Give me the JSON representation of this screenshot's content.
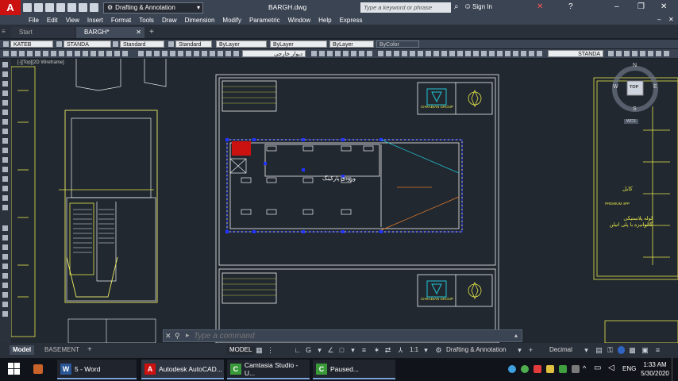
{
  "app": {
    "logo_letter": "A",
    "workspace": "Drafting & Annotation",
    "doc_title": "BARGH.dwg",
    "search_placeholder": "Type a keyword or phrase",
    "signin": "Sign In"
  },
  "menu": [
    "File",
    "Edit",
    "View",
    "Insert",
    "Format",
    "Tools",
    "Draw",
    "Dimension",
    "Modify",
    "Parametric",
    "Window",
    "Help",
    "Express"
  ],
  "tabs": [
    {
      "label": "Start"
    },
    {
      "label": "BARGH*"
    }
  ],
  "props": {
    "textstyle": "KATEB",
    "dimstyle": "STANDA",
    "tablestyle": "Standard",
    "mlstyle": "Standard",
    "layer": "ByLayer",
    "linetype": "ByLayer",
    "lineweight": "ByLayer",
    "color": "ByColor"
  },
  "layer_row": {
    "layer_name": "STANDA",
    "arabic_layer": "دیوار خارجی"
  },
  "viewport": {
    "label": "[-][Top][2D Wireframe]",
    "viewcube_top": "TOP",
    "compass": {
      "n": "N",
      "s": "S",
      "w": "W",
      "e": "E"
    },
    "wcs": "WCS"
  },
  "drawing": {
    "parking_label": "ورودی پارکینگ",
    "logo_text": "CHRABIAN GROUP",
    "legend_1": "کابل",
    "legend_2": "لوله پلاستیکی گالوانیزه با پلی اتیلن",
    "legend_small": "PREMIUM 4PP"
  },
  "command": {
    "placeholder": "Type a command"
  },
  "layouts": [
    {
      "label": "Model"
    },
    {
      "label": "BASEMENT"
    }
  ],
  "status": {
    "model": "MODEL",
    "scale": "1:1",
    "workspace": "Drafting & Annotation",
    "units": "Decimal"
  },
  "taskbar": {
    "apps": [
      {
        "label": "5 - Word",
        "color": "#2b5797",
        "letter": "W"
      },
      {
        "label": "Autodesk AutoCAD...",
        "color": "#c11",
        "letter": "A"
      },
      {
        "label": "Camtasia Studio - U...",
        "color": "#3a9a3a",
        "letter": "C"
      },
      {
        "label": "Paused...",
        "color": "#3a9a3a",
        "letter": "C"
      }
    ],
    "lang": "ENG",
    "time": "1:33 AM",
    "date": "5/30/2020"
  },
  "colors": {
    "accent": "#c11",
    "drawing_bg": "#212830",
    "line_yellow": "#e6e64a",
    "line_white": "#f0f0f0",
    "line_blue": "#2234ff",
    "line_cyan": "#22c4d4",
    "line_orange": "#e07a2c"
  }
}
